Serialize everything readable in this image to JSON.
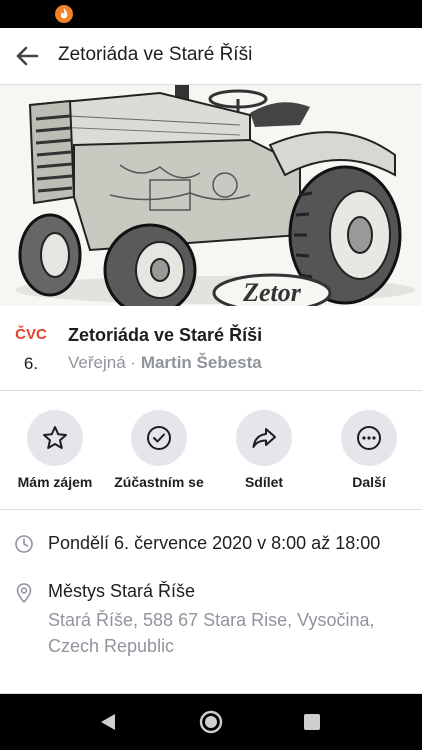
{
  "header": {
    "title": "Zetoriáda ve Staré Říši"
  },
  "cover": {
    "brand_text": "Zetor"
  },
  "event": {
    "month": "ČVC",
    "day": "6.",
    "title": "Zetoriáda ve Staré Říši",
    "privacy": "Veřejná",
    "separator": "·",
    "host": "Martin Šebesta"
  },
  "actions": [
    {
      "label": "Mám zájem",
      "icon": "star-icon"
    },
    {
      "label": "Zúčastním se",
      "icon": "check-circle-icon"
    },
    {
      "label": "Sdílet",
      "icon": "share-icon"
    },
    {
      "label": "Další",
      "icon": "more-icon"
    }
  ],
  "details": {
    "datetime": "Pondělí 6. července 2020 v 8:00 až 18:00",
    "place_name": "Městys Stará Říše",
    "place_address": "Stará Říše, 588 67 Stara Rise, Vysočina, Czech Republic"
  },
  "colors": {
    "accent_date": "#e4402a",
    "secondary_text": "#90949c",
    "action_bg": "#e4e6eb"
  }
}
